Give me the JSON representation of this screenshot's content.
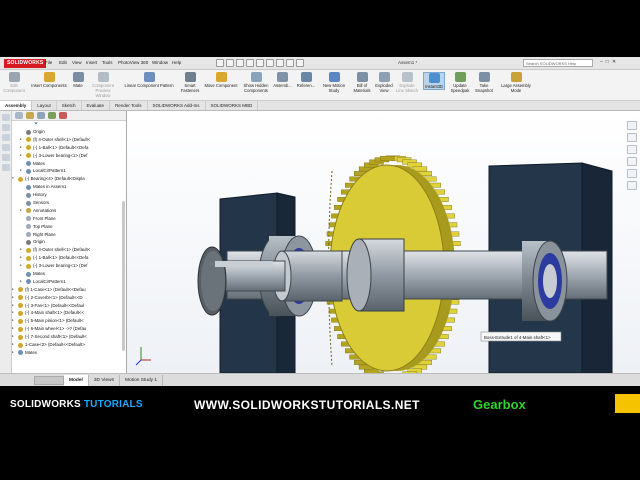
{
  "titlebar": {
    "logo_text": "SOLIDWORKS",
    "menus": [
      "File",
      "Edit",
      "View",
      "Insert",
      "Tools",
      "PhotoView 360",
      "Window",
      "Help"
    ],
    "document_title": "Assem1 *",
    "search_placeholder": "Search SOLIDWORKS Help"
  },
  "ribbon": {
    "commands": [
      {
        "label": "Edit Component",
        "state": "disabled",
        "color": "#9aa4b0"
      },
      {
        "label": "Insert Components",
        "state": "enabled",
        "color": "#d9a62e"
      },
      {
        "label": "Mate",
        "state": "enabled",
        "color": "#7a8da3"
      },
      {
        "label": "Component Preview Window",
        "state": "disabled",
        "color": "#b4bcc6"
      },
      {
        "label": "Linear Component Pattern",
        "state": "enabled",
        "color": "#6c8fbf"
      },
      {
        "label": "Smart Fasteners",
        "state": "enabled",
        "color": "#6f7f90"
      },
      {
        "label": "Move Component",
        "state": "enabled",
        "color": "#d9a62e"
      },
      {
        "label": "Show Hidden Components",
        "state": "enabled",
        "color": "#8aa3bd"
      },
      {
        "label": "Assemb...",
        "state": "enabled",
        "color": "#7f93a8"
      },
      {
        "label": "Referen...",
        "state": "enabled",
        "color": "#6b87a6"
      },
      {
        "label": "New Motion Study",
        "state": "enabled",
        "color": "#5e86c2"
      },
      {
        "label": "Bill of Materials",
        "state": "enabled",
        "color": "#7b8fa5"
      },
      {
        "label": "Exploded View",
        "state": "enabled",
        "color": "#8e9fb3"
      },
      {
        "label": "Explode Line Sketch",
        "state": "disabled",
        "color": "#b8c0ca"
      },
      {
        "label": "Instant3D",
        "state": "active",
        "color": "#4c8fd0"
      },
      {
        "label": "Update Speedpak",
        "state": "enabled",
        "color": "#6f9f5a"
      },
      {
        "label": "Take Snapshot",
        "state": "enabled",
        "color": "#7b8fa5"
      },
      {
        "label": "Large Assembly Mode",
        "state": "enabled",
        "color": "#c9a23a"
      }
    ]
  },
  "tabs": [
    "Assembly",
    "Layout",
    "Sketch",
    "Evaluate",
    "Render Tools",
    "SOLIDWORKS Add-Ins",
    "SOLIDWORKS MBD"
  ],
  "active_tab": "Assembly",
  "tree": {
    "rows": [
      {
        "label": "Origin",
        "indent": 1,
        "icon": "origin-icon",
        "color": "#7a7a7a",
        "expand": ""
      },
      {
        "label": "(f) 4-Outer shell<1> (Default<",
        "indent": 1,
        "icon": "part-icon",
        "color": "#d4a52a",
        "expand": "▸"
      },
      {
        "label": "(-) 1-Ball<1> (Default<<Defa",
        "indent": 1,
        "icon": "part-icon",
        "color": "#d4a52a",
        "expand": "▸"
      },
      {
        "label": "(-) 3-Lower bearing<1> (Def",
        "indent": 1,
        "icon": "part-icon",
        "color": "#d4a52a",
        "expand": "▸"
      },
      {
        "label": "Mates",
        "indent": 1,
        "icon": "mates-icon",
        "color": "#6b8fb5",
        "expand": ""
      },
      {
        "label": "LocalCirPattern1",
        "indent": 1,
        "icon": "pattern-icon",
        "color": "#6b8fb5",
        "expand": "▸"
      },
      {
        "label": "(-) Bearing<4> (Default<Displa",
        "indent": 0,
        "icon": "assembly-icon",
        "color": "#d4a52a",
        "expand": "▾"
      },
      {
        "label": "Mates in Assem1",
        "indent": 1,
        "icon": "mates-icon",
        "color": "#6b8fb5",
        "expand": ""
      },
      {
        "label": "History",
        "indent": 1,
        "icon": "history-icon",
        "color": "#7a8fa8",
        "expand": ""
      },
      {
        "label": "Sensors",
        "indent": 1,
        "icon": "sensor-icon",
        "color": "#7a8fa8",
        "expand": ""
      },
      {
        "label": "Annotations",
        "indent": 1,
        "icon": "annotation-icon",
        "color": "#c9a23a",
        "expand": "▸"
      },
      {
        "label": "Front Plane",
        "indent": 1,
        "icon": "plane-icon",
        "color": "#9aa8b8",
        "expand": ""
      },
      {
        "label": "Top Plane",
        "indent": 1,
        "icon": "plane-icon",
        "color": "#9aa8b8",
        "expand": ""
      },
      {
        "label": "Right Plane",
        "indent": 1,
        "icon": "plane-icon",
        "color": "#9aa8b8",
        "expand": ""
      },
      {
        "label": "Origin",
        "indent": 1,
        "icon": "origin-icon",
        "color": "#7a7a7a",
        "expand": ""
      },
      {
        "label": "(f) 4-Outer shell<1> (Default<",
        "indent": 1,
        "icon": "part-icon",
        "color": "#d4a52a",
        "expand": "▸"
      },
      {
        "label": "(-) 1-Ball<1> (Default<<Defa",
        "indent": 1,
        "icon": "part-icon",
        "color": "#d4a52a",
        "expand": "▸"
      },
      {
        "label": "(-) 3-Lower bearing<1> (Def",
        "indent": 1,
        "icon": "part-icon",
        "color": "#d4a52a",
        "expand": "▸"
      },
      {
        "label": "Mates",
        "indent": 1,
        "icon": "mates-icon",
        "color": "#6b8fb5",
        "expand": ""
      },
      {
        "label": "LocalCirPattern1",
        "indent": 1,
        "icon": "pattern-icon",
        "color": "#6b8fb5",
        "expand": "▸"
      },
      {
        "label": "(f) 1-Case<1> (Default<<Defau",
        "indent": 0,
        "icon": "part-icon",
        "color": "#d4a52a",
        "expand": "▸"
      },
      {
        "label": "(-) 2-Coverbr<1> (Default<<D",
        "indent": 0,
        "icon": "part-icon",
        "color": "#d4a52a",
        "expand": "▸"
      },
      {
        "label": "(-) 3-Fan<1> (Default<<Defaul",
        "indent": 0,
        "icon": "part-icon",
        "color": "#d4a52a",
        "expand": "▸"
      },
      {
        "label": "(-) 4-Main shaft<1> (Default<<",
        "indent": 0,
        "icon": "part-icon",
        "color": "#d4a52a",
        "expand": "▸"
      },
      {
        "label": "(-) 5-Main pinion<1> (Default<",
        "indent": 0,
        "icon": "part-icon",
        "color": "#d4a52a",
        "expand": "▸"
      },
      {
        "label": "(-) 6-Main wheel<1> ->? (Defau",
        "indent": 0,
        "icon": "part-icon",
        "color": "#d4a52a",
        "expand": "▸"
      },
      {
        "label": "(-) 7-Second shaft<1> (Default<",
        "indent": 0,
        "icon": "part-icon",
        "color": "#d4a52a",
        "expand": "▸"
      },
      {
        "label": "1-Case<2> (Default<<Default>",
        "indent": 0,
        "icon": "part-icon",
        "color": "#d4a52a",
        "expand": "▸"
      },
      {
        "label": "Mates",
        "indent": 0,
        "icon": "mates-icon",
        "color": "#6b8fb5",
        "expand": "▸"
      }
    ]
  },
  "viewport": {
    "tooltip": "Boss-Extrude1 of 4-Main shaft<1>",
    "colors": {
      "gear": "#e0d23a",
      "gear_dark": "#b3a41e",
      "plate": "#1f3244",
      "shaft": "#9aa3ad",
      "bearing_ring": "#8a939c",
      "bearing_inner": "#2a3aa8"
    }
  },
  "bottom_tabs": [
    "Model",
    "3D Views",
    "Motion Study 1"
  ],
  "active_bottom_tab": "Model",
  "banner": {
    "left_part1": "SOLIDWORKS",
    "left_part2": "TUTORIALS",
    "site": "WWW.SOLIDWORKSTUTORIALS.NET",
    "topic": "Gearbox",
    "accent_color": "#f6c300"
  }
}
